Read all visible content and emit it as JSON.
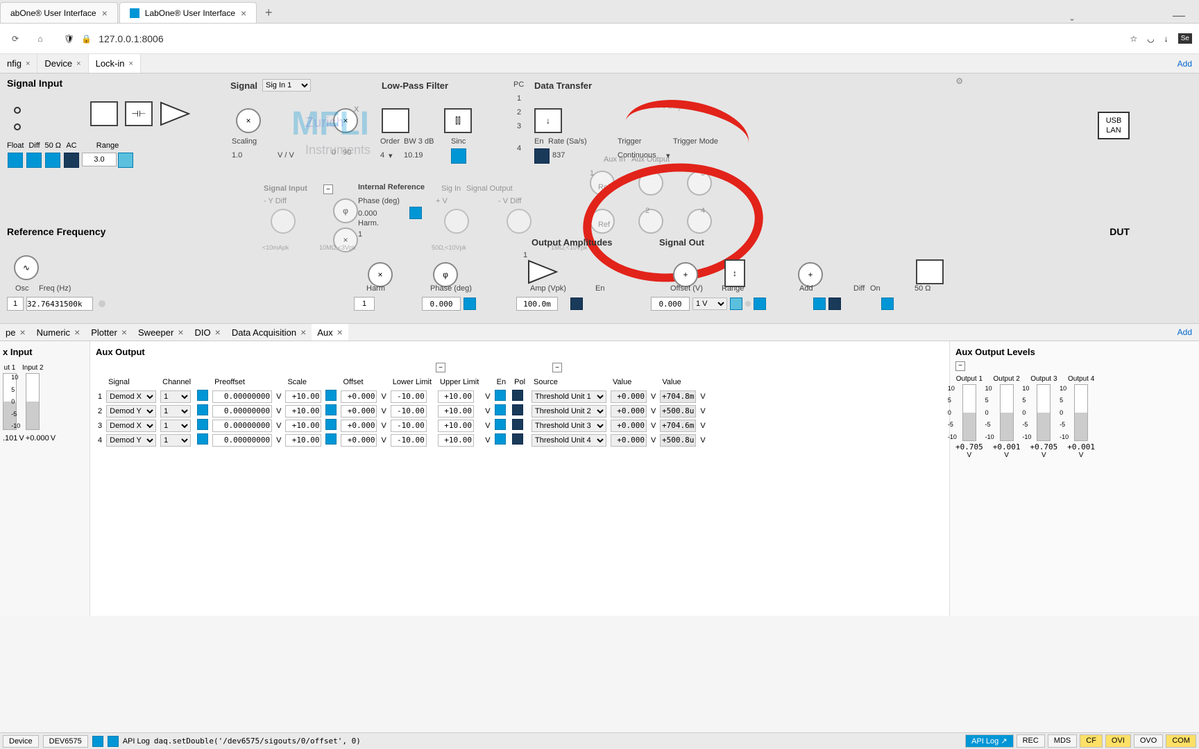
{
  "browser": {
    "tabs": [
      {
        "label": "abOne® User Interface"
      },
      {
        "label": "LabOne® User Interface"
      }
    ],
    "url": "127.0.0.1:8006"
  },
  "app_tabs": {
    "items": [
      {
        "label": "nfig"
      },
      {
        "label": "Device"
      },
      {
        "label": "Lock-in",
        "active": true
      }
    ],
    "add": "Add"
  },
  "signal_input": {
    "title": "Signal Input",
    "float": "Float",
    "diff": "Diff",
    "fifty": "50 Ω",
    "ac": "AC",
    "range": "Range",
    "range_val": "3.0"
  },
  "diagram": {
    "signal": "Signal",
    "sig_in": "Sig In 1",
    "scaling": "Scaling",
    "scaling_val": "1.0",
    "scaling_unit": "V / V",
    "lowpass": "Low-Pass Filter",
    "order": "Order",
    "bw": "BW 3 dB",
    "order_val": "4",
    "bw_val": "10.19",
    "sinc": "Sinc",
    "pc": "PC",
    "data_transfer": "Data Transfer",
    "en": "En",
    "rate": "Rate (Sa/s)",
    "rate_val": "837",
    "trigger": "Trigger",
    "trigger_mode": "Trigger Mode",
    "continuous": "Continuous",
    "aux_in": "Aux In",
    "aux_out": "Aux Output",
    "ref": "Ref",
    "usb": "USB",
    "lan": "LAN",
    "internal_ref": "Internal Reference",
    "phase_deg": "Phase (deg)",
    "phase_val": "0.000",
    "harm": "Harm",
    "harm_val": "1",
    "harm2": "Harm.",
    "signal_input": "Signal Input",
    "y_diff": "- Y Diff",
    "sig_in2": "Sig In",
    "v_diff": "- V Diff",
    "plus_v": "+ V",
    "ten_mv": "<10mApk",
    "ten_v": "10MΩ,<3Vpk",
    "fifty_ohm": "50Ω,<10Vpk",
    "one_m": "1MΩ,<10Vpk",
    "signal_output": "Signal Output",
    "output_amp": "Output Amplitudes",
    "signal_out": "Signal Out",
    "mfli": "MFLI",
    "zurich": "Zurich",
    "instruments": "Instruments",
    "amplifier": "Amplifier"
  },
  "ref_freq": {
    "title": "Reference Frequency",
    "osc": "Osc",
    "freq": "Freq (Hz)",
    "osc_val": "1",
    "freq_val": "32.76431500k",
    "harm": "Harm",
    "harm_val": "1",
    "phase": "Phase (deg)",
    "phase_val": "0.000",
    "amp": "Amp (Vpk)",
    "amp_val": "100.0m",
    "en": "En",
    "offset": "Offset (V)",
    "offset_val": "0.000",
    "range": "Range",
    "range_val": "1 V",
    "add": "Add",
    "diff": "Diff",
    "on": "On",
    "fifty": "50 Ω",
    "dut": "DUT"
  },
  "bottom_tabs": {
    "items": [
      {
        "label": "pe"
      },
      {
        "label": "Numeric"
      },
      {
        "label": "Plotter"
      },
      {
        "label": "Sweeper"
      },
      {
        "label": "DIO"
      },
      {
        "label": "Data Acquisition"
      },
      {
        "label": "Aux",
        "active": true
      }
    ],
    "add": "Add"
  },
  "aux_input": {
    "title": "x Input",
    "in1": "ut 1",
    "in2": "Input 2",
    "val1": ".101",
    "val2": "+0.000",
    "unit": "V"
  },
  "aux_output": {
    "title": "Aux Output",
    "headers": {
      "num": "",
      "signal": "Signal",
      "channel": "Channel",
      "preoffset": "Preoffset",
      "scale": "Scale",
      "offset": "Offset",
      "lower": "Lower Limit",
      "upper": "Upper Limit",
      "en": "En",
      "pol": "Pol",
      "source": "Source",
      "value1": "Value",
      "value2": "Value"
    },
    "rows": [
      {
        "num": "1",
        "signal": "Demod X",
        "channel": "1",
        "preoffset": "0.00000000",
        "scale": "+10.00",
        "offset": "+0.000",
        "lower": "-10.00",
        "upper": "+10.00",
        "source": "Threshold Unit 1",
        "val1": "+0.000",
        "val2": "+704.8m"
      },
      {
        "num": "2",
        "signal": "Demod Y",
        "channel": "1",
        "preoffset": "0.00000000",
        "scale": "+10.00",
        "offset": "+0.000",
        "lower": "-10.00",
        "upper": "+10.00",
        "source": "Threshold Unit 2",
        "val1": "+0.000",
        "val2": "+500.8u"
      },
      {
        "num": "3",
        "signal": "Demod X",
        "channel": "1",
        "preoffset": "0.00000000",
        "scale": "+10.00",
        "offset": "+0.000",
        "lower": "-10.00",
        "upper": "+10.00",
        "source": "Threshold Unit 3",
        "val1": "+0.000",
        "val2": "+704.6m"
      },
      {
        "num": "4",
        "signal": "Demod Y",
        "channel": "1",
        "preoffset": "0.00000000",
        "scale": "+10.00",
        "offset": "+0.000",
        "lower": "-10.00",
        "upper": "+10.00",
        "source": "Threshold Unit 4",
        "val1": "+0.000",
        "val2": "+500.8u"
      }
    ],
    "u": "V"
  },
  "aux_levels": {
    "title": "Aux Output Levels",
    "out1": "Output 1",
    "out2": "Output 2",
    "out3": "Output 3",
    "out4": "Output 4",
    "v1": "+0.705",
    "v2": "+0.001",
    "v3": "+0.705",
    "v4": "+0.001",
    "u": "V",
    "ticks": [
      "10",
      "5",
      "0",
      "-5",
      "-10"
    ]
  },
  "status": {
    "device": "Device",
    "dev_id": "DEV6575",
    "api": "API Log",
    "cmd": "daq.setDouble('/dev6575/sigouts/0/offset', 0)",
    "api_link": "API Log",
    "rec": "REC",
    "mds": "MDS",
    "cf": "CF",
    "ovi": "OVI",
    "ovo": "OVO",
    "com": "COM"
  }
}
